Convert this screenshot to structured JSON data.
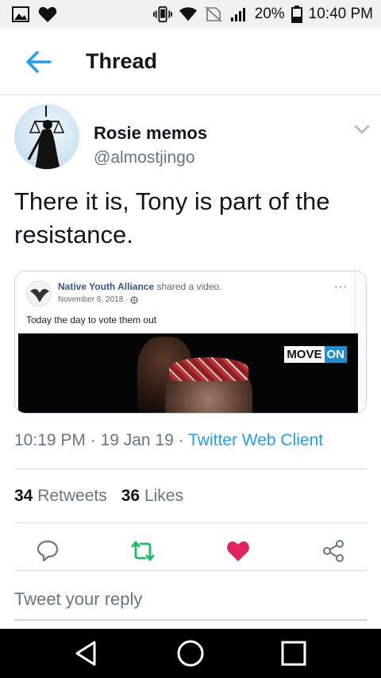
{
  "status_bar": {
    "battery_percent": "20%",
    "time": "10:40 PM",
    "icons": [
      "image-icon",
      "heart-icon",
      "vibrate-icon",
      "wifi-icon",
      "no-sim-icon",
      "signal-icon",
      "battery-icon"
    ]
  },
  "header": {
    "title": "Thread",
    "back_icon": "arrow-left-icon",
    "accent_color": "#1da1f2"
  },
  "tweet": {
    "author_name": "Rosie memos",
    "author_handle": "@almostjingo",
    "text": "There it is, Tony is part of the resistance.",
    "embedded_post": {
      "page_name": "Native Youth Alliance",
      "action": " shared a video.",
      "date": "November 6, 2018 ·",
      "body": "Today the day to vote them out",
      "more": "···",
      "video_logo_move": "MOVE",
      "video_logo_on": "ON"
    },
    "time": "10:19 PM",
    "date": "19 Jan 19",
    "separator": " · ",
    "client": "Twitter Web Client",
    "retweets_count": "34",
    "retweets_label": "Retweets",
    "likes_count": "36",
    "likes_label": "Likes"
  },
  "actions": {
    "reply_icon": "reply-icon",
    "retweet_icon": "retweet-icon",
    "like_icon": "heart-filled-icon",
    "share_icon": "share-icon",
    "retweet_color": "#17bf63",
    "like_color": "#e0245e"
  },
  "reply": {
    "placeholder": "Tweet your reply"
  },
  "nav": {
    "buttons": [
      "back-triangle-icon",
      "home-circle-icon",
      "recents-square-icon"
    ]
  }
}
